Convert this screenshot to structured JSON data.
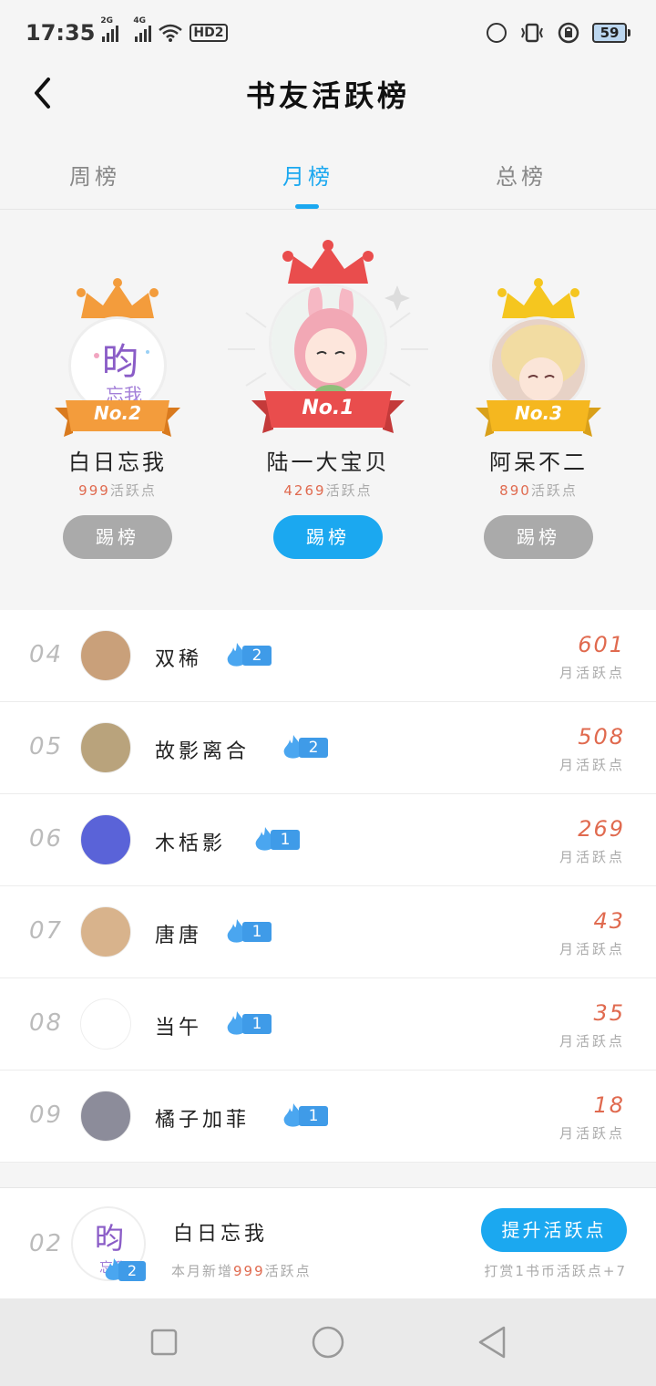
{
  "status_bar": {
    "time": "17:35",
    "signal1": "2G",
    "signal2": "4G",
    "hd": "HD2",
    "battery": "59"
  },
  "header": {
    "title": "书友活跃榜"
  },
  "tabs": [
    {
      "label": "周榜"
    },
    {
      "label": "月榜"
    },
    {
      "label": "总榜"
    }
  ],
  "podium": {
    "first": {
      "rank": "No.1",
      "name": "陆一大宝贝",
      "points": "4269",
      "points_suffix": "活跃点",
      "button": "踢榜"
    },
    "second": {
      "rank": "No.2",
      "name": "白日忘我",
      "points": "999",
      "points_suffix": "活跃点",
      "button": "踢榜"
    },
    "third": {
      "rank": "No.3",
      "name": "阿呆不二",
      "points": "890",
      "points_suffix": "活跃点",
      "button": "踢榜"
    }
  },
  "list": [
    {
      "rank": "04",
      "name": "双稀",
      "level": "2",
      "score": "601",
      "score_label": "月活跃点",
      "avatar_color": "#c9a07a"
    },
    {
      "rank": "05",
      "name": "故影离合",
      "level": "2",
      "score": "508",
      "score_label": "月活跃点",
      "avatar_color": "#b9a37c"
    },
    {
      "rank": "06",
      "name": "木栝影",
      "level": "1",
      "score": "269",
      "score_label": "月活跃点",
      "avatar_color": "#5a63d8"
    },
    {
      "rank": "07",
      "name": "唐唐",
      "level": "1",
      "score": "43",
      "score_label": "月活跃点",
      "avatar_color": "#d8b38c"
    },
    {
      "rank": "08",
      "name": "当午",
      "level": "1",
      "score": "35",
      "score_label": "月活跃点",
      "avatar_color": "#ffffff"
    },
    {
      "rank": "09",
      "name": "橘子加菲",
      "level": "1",
      "score": "18",
      "score_label": "月活跃点",
      "avatar_color": "#8c8c9a"
    }
  ],
  "my_rank": {
    "rank": "02",
    "name": "白日忘我",
    "level": "2",
    "sub_prefix": "本月新增",
    "sub_num": "999",
    "sub_suffix": "活跃点",
    "button": "提升活跃点",
    "hint": "打赏1书币活跃点+7"
  },
  "colors": {
    "accent": "#1ba8f0",
    "score": "#e06a4f",
    "gold": "#f5a623",
    "silver_orange": "#f39c3c",
    "red": "#e94d4d",
    "level_blue": "#3f9be8"
  },
  "icons": {
    "back": "chevron-left-icon",
    "crown": "crown-icon",
    "flame": "flame-icon",
    "nav_square": "square-icon",
    "nav_circle": "circle-icon",
    "nav_triangle": "triangle-back-icon"
  }
}
